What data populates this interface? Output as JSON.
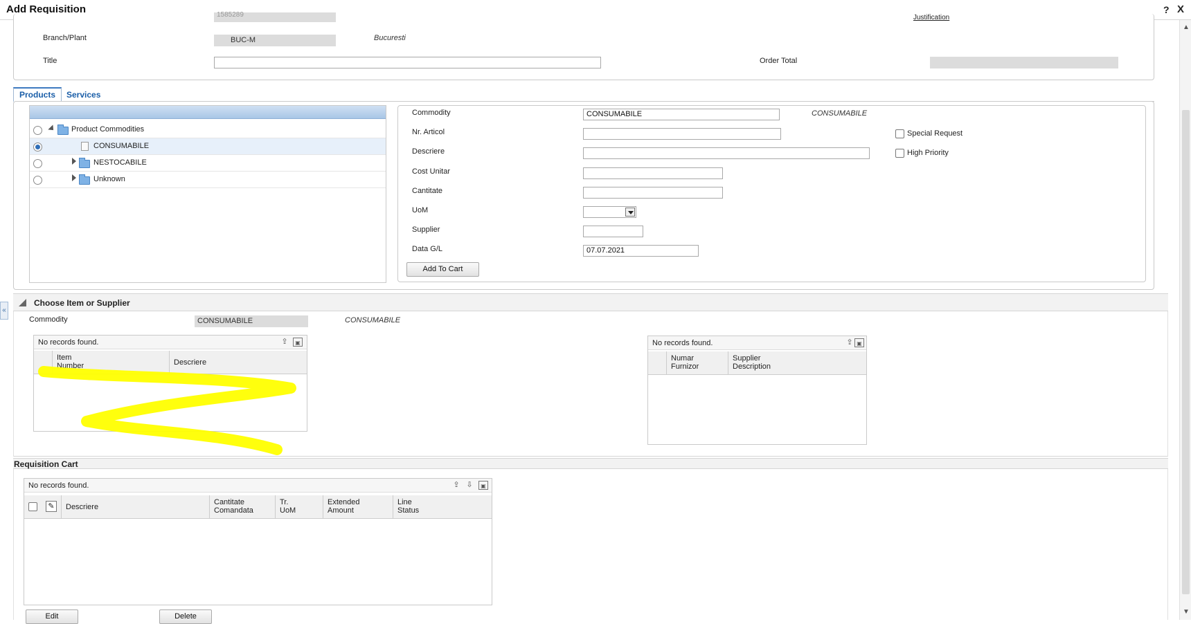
{
  "window": {
    "title": "Add Requisition",
    "help": "?",
    "close": "X"
  },
  "header": {
    "partial_top_value": "1585289",
    "partial_top_right_link": "Justification",
    "branch_label": "Branch/Plant",
    "branch_value": "BUC-M",
    "branch_desc": "Bucuresti",
    "title_label": "Title",
    "title_value": "",
    "order_total_label": "Order Total",
    "order_total_value": ""
  },
  "tabs": [
    {
      "label": "Products",
      "active": true
    },
    {
      "label": "Services",
      "active": false
    }
  ],
  "tree": {
    "rows": [
      {
        "label": "Product Commodities",
        "selected": false
      },
      {
        "label": "CONSUMABILE",
        "selected": true
      },
      {
        "label": "NESTOCABILE",
        "selected": false
      },
      {
        "label": "Unknown",
        "selected": false
      }
    ]
  },
  "form": {
    "commodity_label": "Commodity",
    "commodity_value": "CONSUMABILE",
    "commodity_desc": "CONSUMABILE",
    "nr_articol_label": "Nr. Articol",
    "descriere_label": "Descriere",
    "cost_unitar_label": "Cost Unitar",
    "cantitate_label": "Cantitate",
    "uom_label": "UoM",
    "supplier_label": "Supplier",
    "data_gl_label": "Data G/L",
    "data_gl_value": "07.07.2021",
    "special_request_label": "Special Request",
    "high_priority_label": "High Priority",
    "add_to_cart_label": "Add To Cart"
  },
  "choose": {
    "section_title": "Choose Item or Supplier",
    "commodity_label": "Commodity",
    "commodity_value": "CONSUMABILE",
    "commodity_desc": "CONSUMABILE",
    "items_grid": {
      "status": "No records found.",
      "col1_line1": "Item",
      "col1_line2": "Number",
      "col2": "Descriere"
    },
    "supplier_grid": {
      "status": "No records found.",
      "col1_line1": "Numar",
      "col1_line2": "Furnizor",
      "col2_line1": "Supplier",
      "col2_line2": "Description"
    }
  },
  "cart": {
    "section_title": "Requisition Cart",
    "status": "No records found.",
    "columns": [
      {
        "line1": "Descriere",
        "line2": ""
      },
      {
        "line1": "Cantitate",
        "line2": "Comandata"
      },
      {
        "line1": "Tr.",
        "line2": "UoM"
      },
      {
        "line1": "Extended",
        "line2": "Amount"
      },
      {
        "line1": "Line",
        "line2": "Status"
      }
    ],
    "edit_label": "Edit",
    "delete_label": "Delete"
  },
  "colors": {
    "accent": "#1a5ea8",
    "highlight": "#ffff00",
    "section_bg": "#f2f2f2"
  }
}
